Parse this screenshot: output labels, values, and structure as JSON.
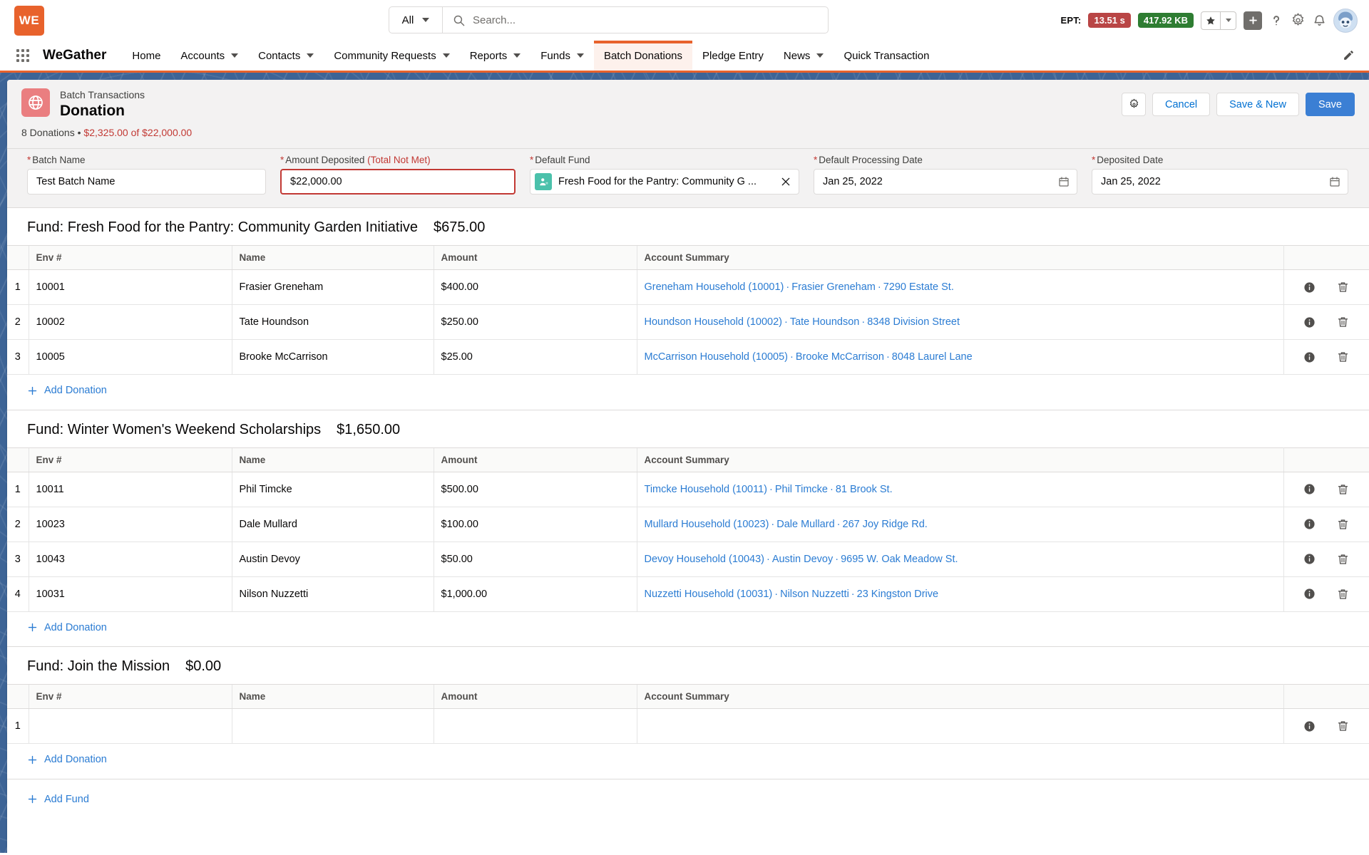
{
  "global_header": {
    "logo_text": "WE",
    "search": {
      "scope": "All",
      "placeholder": "Search...",
      "value": ""
    },
    "ept_label": "EPT:",
    "ept_time": "13.51 s",
    "ept_size": "417.92 KB",
    "icons": [
      "star-icon",
      "chevron-down-icon",
      "plus-icon",
      "help-icon",
      "setup-gear-icon",
      "notifications-bell-icon",
      "avatar"
    ]
  },
  "nav": {
    "app_name": "WeGather",
    "items": [
      {
        "label": "Home",
        "has_menu": false,
        "active": false
      },
      {
        "label": "Accounts",
        "has_menu": true,
        "active": false
      },
      {
        "label": "Contacts",
        "has_menu": true,
        "active": false
      },
      {
        "label": "Community Requests",
        "has_menu": true,
        "active": false
      },
      {
        "label": "Reports",
        "has_menu": true,
        "active": false
      },
      {
        "label": "Funds",
        "has_menu": true,
        "active": false
      },
      {
        "label": "Batch Donations",
        "has_menu": false,
        "active": true
      },
      {
        "label": "Pledge Entry",
        "has_menu": false,
        "active": false
      },
      {
        "label": "News",
        "has_menu": true,
        "active": false
      },
      {
        "label": "Quick Transaction",
        "has_menu": false,
        "active": false
      }
    ]
  },
  "record": {
    "object_label": "Batch Transactions",
    "title": "Donation",
    "meta_count": "8 Donations",
    "meta_bullet": "•",
    "meta_amount": "$2,325.00 of $22,000.00",
    "accent_color": "#c23934",
    "actions": {
      "settings_icon": "gear-icon",
      "cancel": "Cancel",
      "save_new": "Save & New",
      "save": "Save"
    }
  },
  "fields": [
    {
      "key": "batch_name",
      "label": "Batch Name",
      "required": true,
      "value": "Test Batch Name",
      "type": "text",
      "error": false
    },
    {
      "key": "amount_deposited",
      "label": "Amount Deposited",
      "suffix": "(Total Not Met)",
      "required": true,
      "value": "$22,000.00",
      "type": "text",
      "error": true
    },
    {
      "key": "default_fund",
      "label": "Default Fund",
      "required": true,
      "value": "Fresh Food for the Pantry: Community G ...",
      "type": "lookup-pill",
      "error": false
    },
    {
      "key": "default_processing_date",
      "label": "Default Processing Date",
      "required": true,
      "value": "Jan 25, 2022",
      "type": "date",
      "error": false
    },
    {
      "key": "deposited_date",
      "label": "Deposited Date",
      "required": true,
      "value": "Jan 25, 2022",
      "type": "date",
      "error": false
    }
  ],
  "table_columns": [
    "Env #",
    "Name",
    "Amount",
    "Account Summary"
  ],
  "funds": [
    {
      "prefix": "Fund:",
      "name": "Fresh Food for the Pantry: Community Garden Initiative",
      "total": "$675.00",
      "rows": [
        {
          "idx": "1",
          "env": "10001",
          "name": "Frasier Greneham",
          "amount": "$400.00",
          "account": [
            "Greneham Household (10001)",
            "Frasier Greneham",
            "7290 Estate St."
          ]
        },
        {
          "idx": "2",
          "env": "10002",
          "name": "Tate Houndson",
          "amount": "$250.00",
          "account": [
            "Houndson Household (10002)",
            "Tate Houndson",
            "8348 Division Street"
          ]
        },
        {
          "idx": "3",
          "env": "10005",
          "name": "Brooke McCarrison",
          "amount": "$25.00",
          "account": [
            "McCarrison Household (10005)",
            "Brooke McCarrison",
            "8048 Laurel Lane"
          ]
        }
      ],
      "add_label": "Add Donation"
    },
    {
      "prefix": "Fund:",
      "name": "Winter Women's Weekend Scholarships",
      "total": "$1,650.00",
      "rows": [
        {
          "idx": "1",
          "env": "10011",
          "name": "Phil Timcke",
          "amount": "$500.00",
          "account": [
            "Timcke Household (10011)",
            "Phil Timcke",
            "81 Brook St."
          ]
        },
        {
          "idx": "2",
          "env": "10023",
          "name": "Dale Mullard",
          "amount": "$100.00",
          "account": [
            "Mullard Household (10023)",
            "Dale Mullard",
            "267 Joy Ridge Rd."
          ]
        },
        {
          "idx": "3",
          "env": "10043",
          "name": "Austin Devoy",
          "amount": "$50.00",
          "account": [
            "Devoy Household (10043)",
            "Austin Devoy",
            "9695 W. Oak Meadow St."
          ]
        },
        {
          "idx": "4",
          "env": "10031",
          "name": "Nilson Nuzzetti",
          "amount": "$1,000.00",
          "account": [
            "Nuzzetti Household (10031)",
            "Nilson Nuzzetti",
            "23 Kingston Drive"
          ]
        }
      ],
      "add_label": "Add Donation"
    },
    {
      "prefix": "Fund:",
      "name": "Join the Mission",
      "total": "$0.00",
      "rows": [
        {
          "idx": "1",
          "env": "",
          "name": "",
          "amount": "",
          "account": []
        }
      ],
      "add_label": "Add Donation"
    }
  ],
  "add_fund_label": "Add Fund",
  "row_action_icons": {
    "info": "info-icon",
    "delete": "trash-icon"
  },
  "colors": {
    "brand_orange": "#e8622c",
    "link_blue": "#2b7cd3",
    "error_red": "#c23934",
    "page_blue": "#3d6496"
  }
}
